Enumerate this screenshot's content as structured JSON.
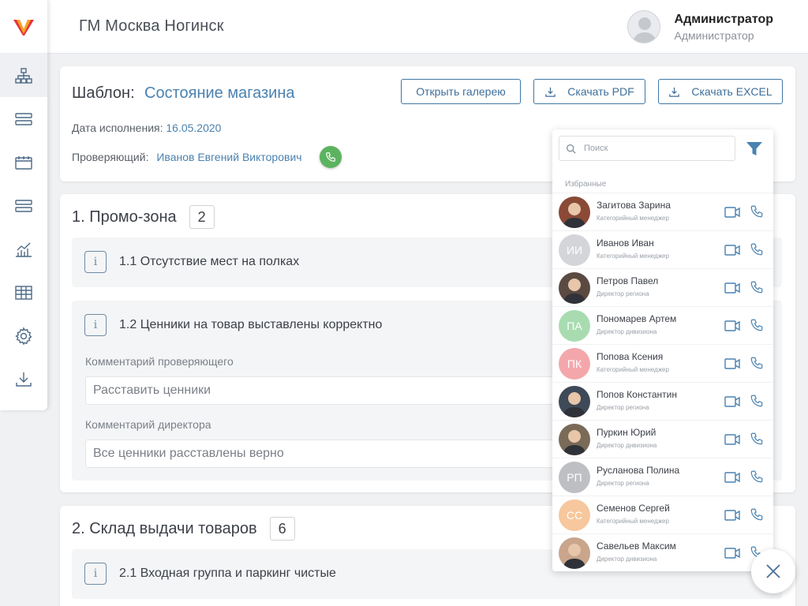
{
  "header": {
    "title": "ГМ Москва Ногинск"
  },
  "user": {
    "name": "Администратор",
    "role": "Администратор"
  },
  "template": {
    "label": "Шаблон:",
    "name": "Состояние магазина",
    "buttons": {
      "gallery": "Открыть галерею",
      "pdf": "Скачать PDF",
      "excel": "Скачать EXCEL"
    },
    "date_label": "Дата исполнения:",
    "date_value": "16.05.2020",
    "inspector_label": "Проверяющий:",
    "inspector_value": "Иванов Евгений Викторович"
  },
  "sections": [
    {
      "title": "1. Промо-зона",
      "count": "2",
      "items": [
        {
          "title": "1.1 Отсутствие мест на полках"
        },
        {
          "title": "1.2 Ценники на товар выставлены корректно",
          "inspector_comment_label": "Комментарий проверяющего",
          "inspector_comment": "Расставить ценники",
          "director_comment_label": "Комментарий директора",
          "director_comment": "Все ценники расставлены верно"
        }
      ]
    },
    {
      "title": "2. Склад выдачи товаров",
      "count": "6",
      "items": [
        {
          "title": "2.1 Входная группа и паркинг чистые"
        }
      ]
    }
  ],
  "contacts_popup": {
    "search_placeholder": "Поиск",
    "favorites_label": "Избранные",
    "contacts": [
      {
        "name": "Загитова Зарина",
        "role": "Категорийный менеджер",
        "initials": "",
        "color": "#8a4a36"
      },
      {
        "name": "Иванов Иван",
        "role": "Категорийный менеджер",
        "initials": "ИИ",
        "color": "#d3d5d9"
      },
      {
        "name": "Петров Павел",
        "role": "Директор региона",
        "initials": "",
        "color": "#5a4a42"
      },
      {
        "name": "Пономарев Артем",
        "role": "Директор дивизиона",
        "initials": "ПА",
        "color": "#a8dcb0"
      },
      {
        "name": "Попова Ксения",
        "role": "Категорийный менеджер",
        "initials": "ПК",
        "color": "#f4a7ab"
      },
      {
        "name": "Попов Константин",
        "role": "Директор региона",
        "initials": "",
        "color": "#3e4a58"
      },
      {
        "name": "Пуркин Юрий",
        "role": "Директор дивизиона",
        "initials": "",
        "color": "#7a6a58"
      },
      {
        "name": "Русланова Полина",
        "role": "Директор региона",
        "initials": "РП",
        "color": "#bdbfc3"
      },
      {
        "name": "Семенов Сергей",
        "role": "Категорийный менеджер",
        "initials": "СС",
        "color": "#f7c79d"
      },
      {
        "name": "Савельев Максим",
        "role": "Директор дивизиона",
        "initials": "",
        "color": "#c9a58c"
      }
    ]
  },
  "colors": {
    "accent": "#4a82b0",
    "green": "#5cb35f",
    "icon": "#4d6a86"
  }
}
